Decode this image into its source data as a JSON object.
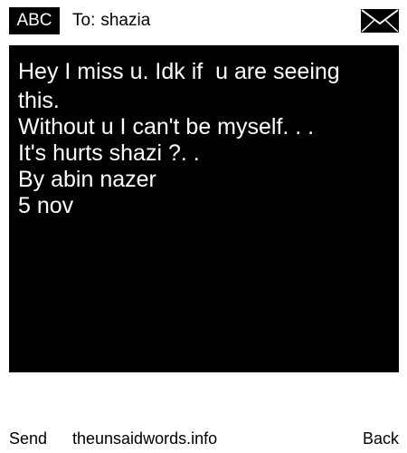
{
  "header": {
    "input_mode": "ABC",
    "to_prefix": "To:",
    "recipient": "shazia",
    "icon": "envelope-icon"
  },
  "message": {
    "lines": [
      "Hey I miss u. Idk if  u are seeing",
      "this.",
      "Without u I can't be myself. . .",
      "It's hurts shazi ?. .",
      "By abin nazer",
      "5 nov"
    ]
  },
  "footer": {
    "left_softkey": "Send",
    "site": "theunsaidwords.info",
    "right_softkey": "Back"
  },
  "colors": {
    "background": "#ffffff",
    "message_background": "#000000",
    "message_text": "#ffffff",
    "text": "#000000"
  }
}
